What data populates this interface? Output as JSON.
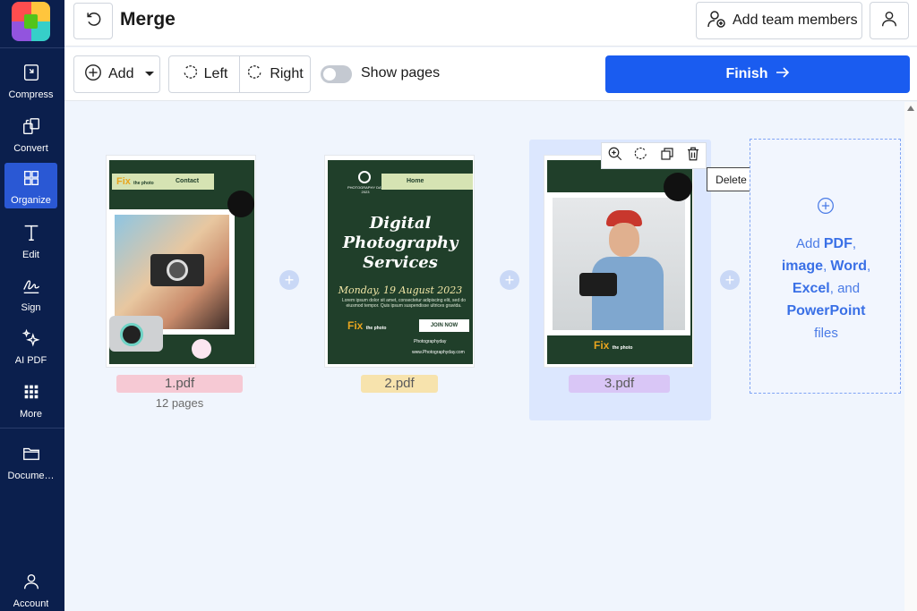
{
  "sidebar": {
    "items": [
      {
        "label": "Compress",
        "icon": "compress-icon"
      },
      {
        "label": "Convert",
        "icon": "convert-icon"
      },
      {
        "label": "Organize",
        "icon": "organize-icon"
      },
      {
        "label": "Edit",
        "icon": "edit-text-icon"
      },
      {
        "label": "Sign",
        "icon": "sign-icon"
      },
      {
        "label": "AI PDF",
        "icon": "sparkle-icon"
      },
      {
        "label": "More",
        "icon": "grid-dots-icon"
      },
      {
        "label": "Docume…",
        "icon": "folder-icon"
      }
    ],
    "account_label": "Account",
    "active": "Organize"
  },
  "header": {
    "title": "Merge",
    "add_team_label": "Add team members"
  },
  "toolbar": {
    "add_label": "Add",
    "rotate_left_label": "Left",
    "rotate_right_label": "Right",
    "show_pages_label": "Show pages",
    "show_pages_on": false,
    "finish_label": "Finish"
  },
  "files": [
    {
      "name": "1.pdf",
      "pages": "12 pages",
      "name_bg": "#f6c9d4"
    },
    {
      "name": "2.pdf",
      "pages": "",
      "name_bg": "#f7e3ad"
    },
    {
      "name": "3.pdf",
      "pages": "",
      "name_bg": "#d9c6f6",
      "selected": true
    }
  ],
  "art": {
    "one": {
      "brand": "Fix",
      "brand_small": "the photo",
      "nav": "Contact"
    },
    "two": {
      "tagline": "PHOTOGRAPHY DAY 2023",
      "nav": "Home",
      "headline_1": "Digital",
      "headline_2": "Photography",
      "headline_3": "Services",
      "date": "Monday, 19 August 2023",
      "body": "Lorem ipsum dolor sit amet, consectetur adipiscing elit, sed do eiusmod tempor. Quis ipsum suspendisse ultrices gravida.",
      "brand": "Fix",
      "brand_small": "the photo",
      "cta": "JOIN NOW",
      "handle": "Photographyday",
      "url": "www.Photographyday.com"
    },
    "three": {
      "brand": "Fix",
      "brand_small": "the photo"
    }
  },
  "card_tools": {
    "tooltip": "Delete",
    "icons": [
      "zoom-in-icon",
      "rotate-icon",
      "duplicate-icon",
      "trash-icon"
    ]
  },
  "drop_zone": {
    "add": "Add",
    "pdf": "PDF",
    "image": "image",
    "word": "Word",
    "excel": "Excel",
    "and": "and",
    "powerpoint": "PowerPoint",
    "files": "files"
  },
  "colors": {
    "sidebar_bg": "#0b1f4d",
    "accent": "#1a5cf0",
    "canvas_bg": "#f0f5fd"
  }
}
